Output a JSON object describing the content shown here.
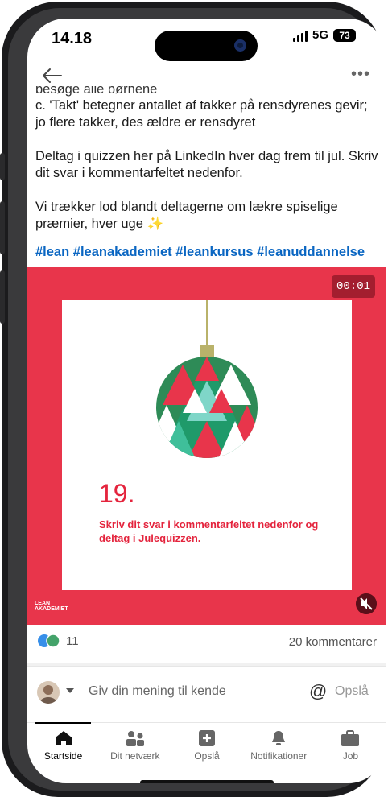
{
  "status_bar": {
    "time": "14.18",
    "network": "5G",
    "battery": "73"
  },
  "post": {
    "cut_line": "besøge alle børnene",
    "line_c": "c. 'Takt' betegner antallet af takker på rensdyrenes gevir; jo flere takker, des ældre er rensdyret",
    "para_quiz": "Deltag i quizzen her på LinkedIn hver dag frem til jul. Skriv dit svar i kommentarfeltet nedenfor.",
    "para_prize": "Vi trækker lod blandt deltagerne om lækre spiselige præmier, hver uge ✨",
    "hashtags": "#lean #leanakademiet #leankursus #leanuddannelse"
  },
  "video": {
    "timer": "00:01",
    "day_number": "19.",
    "card_text": "Skriv dit svar i kommentarfeltet nedenfor og deltag i Julequizzen.",
    "logo_line1": "LEAN",
    "logo_line2": "AKADEMIET"
  },
  "social": {
    "reactions_count": "11",
    "comments_count": "20 kommentarer"
  },
  "comment_bar": {
    "placeholder": "Giv din mening til kende",
    "post_label": "Opslå"
  },
  "bottom_nav": [
    {
      "label": "Startside",
      "icon": "home-icon"
    },
    {
      "label": "Dit netværk",
      "icon": "network-icon"
    },
    {
      "label": "Opslå",
      "icon": "post-icon"
    },
    {
      "label": "Notifikationer",
      "icon": "bell-icon"
    },
    {
      "label": "Job",
      "icon": "briefcase-icon"
    }
  ],
  "colors": {
    "media_bg": "#e8354b",
    "accent_red": "#e4243d",
    "link_blue": "#0a66c2"
  }
}
